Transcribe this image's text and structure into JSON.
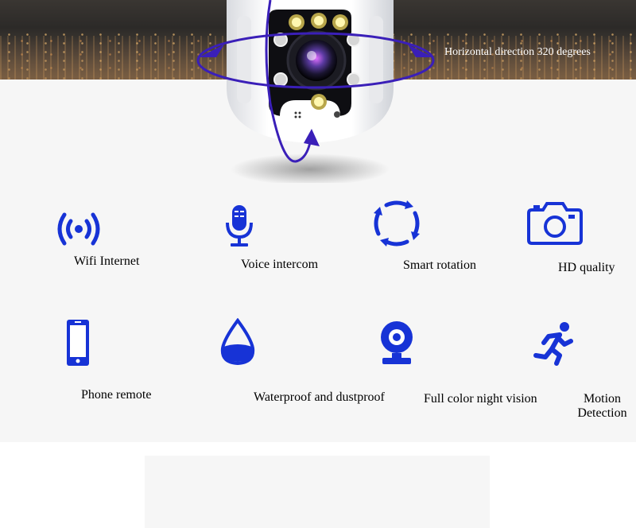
{
  "hero": {
    "caption": "Horizontal direction 320 degrees"
  },
  "features": [
    {
      "label": "Wifi Internet",
      "icon": "wifi-signal-icon"
    },
    {
      "label": "Voice intercom",
      "icon": "microphone-icon"
    },
    {
      "label": "Smart rotation",
      "icon": "rotation-arrows-icon"
    },
    {
      "label": "HD quality",
      "icon": "camera-icon"
    },
    {
      "label": "Phone remote",
      "icon": "smartphone-icon"
    },
    {
      "label": "Waterproof and dustproof",
      "icon": "water-drop-icon"
    },
    {
      "label": "Full color night vision",
      "icon": "webcam-icon"
    },
    {
      "label": "Motion Detection",
      "icon": "running-person-icon"
    }
  ],
  "colors": {
    "icon_blue": "#1733d6",
    "arrow_purple": "#3a1fb8",
    "background": "#f6f6f6"
  }
}
